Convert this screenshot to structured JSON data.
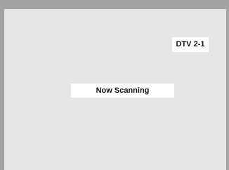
{
  "screen": {
    "channel": "DTV 2-1",
    "status": "Now Scanning"
  },
  "colors": {
    "frame": "#a3a3a3",
    "screen_background": "#e6e6e6",
    "label_background": "#ffffff",
    "text": "#111111"
  }
}
